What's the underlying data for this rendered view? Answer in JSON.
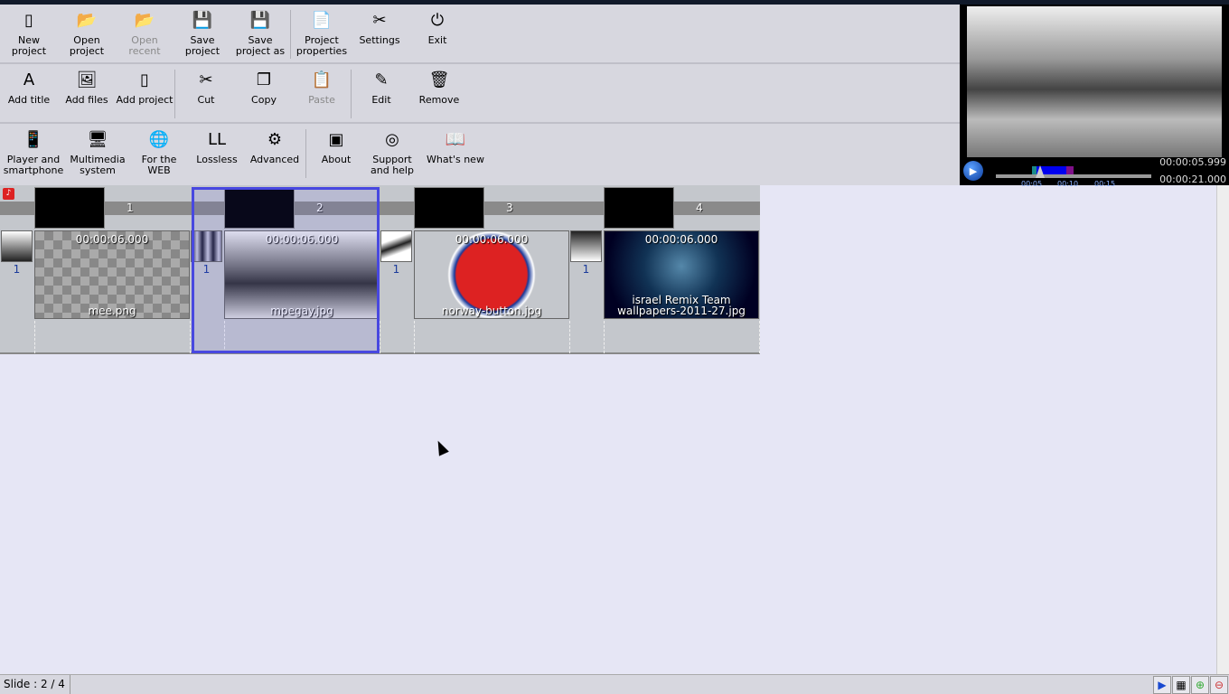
{
  "toolbar1": [
    {
      "label": "New project",
      "icon": "new-file-icon"
    },
    {
      "label": "Open project",
      "icon": "folder-open-icon"
    },
    {
      "label": "Open recent",
      "icon": "open-recent-icon",
      "disabled": true
    },
    {
      "label": "Save project",
      "icon": "floppy-icon"
    },
    {
      "label": "Save project as",
      "icon": "floppy-saveas-icon"
    },
    {
      "label": "Project properties",
      "icon": "document-icon"
    },
    {
      "label": "Settings",
      "icon": "tools-icon"
    },
    {
      "label": "Exit",
      "icon": "power-icon"
    }
  ],
  "toolbar2": [
    {
      "label": "Add title",
      "icon": "add-title-icon"
    },
    {
      "label": "Add files",
      "icon": "add-image-icon"
    },
    {
      "label": "Add project",
      "icon": "add-project-icon"
    },
    {
      "label": "Cut",
      "icon": "scissors-icon"
    },
    {
      "label": "Copy",
      "icon": "copy-icon"
    },
    {
      "label": "Paste",
      "icon": "paste-icon",
      "disabled": true
    },
    {
      "label": "Edit",
      "icon": "pen-icon"
    },
    {
      "label": "Remove",
      "icon": "trash-icon"
    }
  ],
  "toolbar3": [
    {
      "label": "Player and smartphone",
      "icon": "smartphone-icon"
    },
    {
      "label": "Multimedia system",
      "icon": "tv-icon"
    },
    {
      "label": "For the WEB",
      "icon": "globe-icon"
    },
    {
      "label": "Lossless",
      "icon": "lossless-icon"
    },
    {
      "label": "Advanced",
      "icon": "gear-icon"
    },
    {
      "label": "About",
      "icon": "about-icon"
    },
    {
      "label": "Support and help",
      "icon": "lifebuoy-icon"
    },
    {
      "label": "What's new",
      "icon": "book-icon"
    }
  ],
  "preview": {
    "current_time": "00:00:05.999",
    "total_time": "00:00:21.000",
    "ticks": [
      "00:05",
      "00:10",
      "00:15"
    ],
    "progress_fraction": 0.2857
  },
  "timeline": {
    "slides": [
      {
        "number": "1",
        "duration": "00:00:06.000",
        "file": "mee.png",
        "transition": "1"
      },
      {
        "number": "2",
        "duration": "00:00:06.000",
        "file": "mpegay.jpg",
        "transition": "1"
      },
      {
        "number": "3",
        "duration": "00:00:06.000",
        "file": "norway-button.jpg",
        "transition": "1"
      },
      {
        "number": "4",
        "duration": "00:00:06.000",
        "file": "israel Remix Team wallpapers-2011-27.jpg",
        "transition": "1"
      }
    ],
    "selected": 2
  },
  "status": {
    "slide": "Slide : 2 / 4"
  },
  "colors": {
    "selection": "#4848e0",
    "background": "#e6e6f5",
    "toolbar": "#d7d7df"
  }
}
